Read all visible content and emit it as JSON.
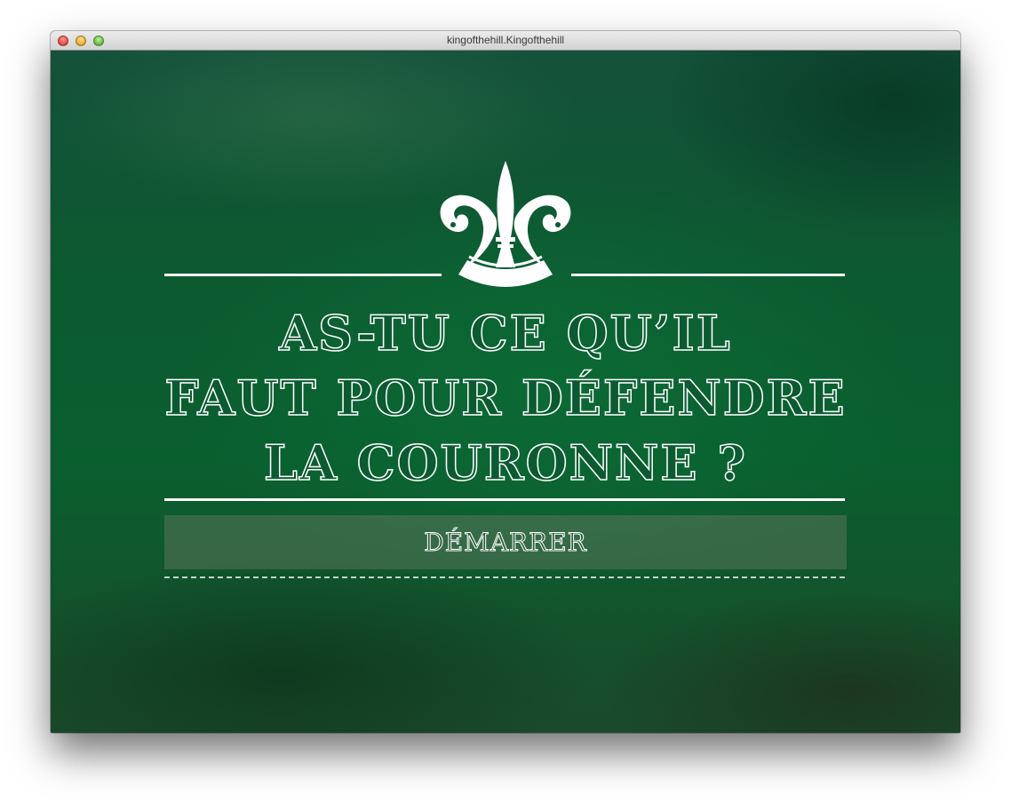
{
  "window": {
    "title": "kingofthehill.Kingofthehill"
  },
  "main": {
    "emblem_icon": "fleur-de-lis-icon",
    "headline_lines": [
      "AS-TU CE QU’IL",
      "FAUT POUR DÉFENDRE",
      "LA COURONNE ?"
    ],
    "start_button_label": "DÉMARRER"
  },
  "colors": {
    "background": "#0b5a31",
    "text": "#ffffff"
  }
}
